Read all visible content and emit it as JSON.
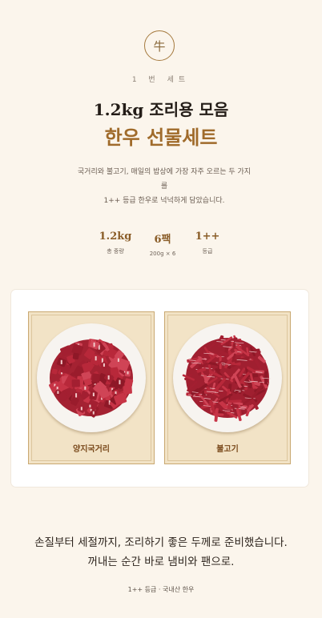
{
  "hero": {
    "emblem_char": "牛",
    "set_number": "1 번 세트",
    "title_line1": "1.2kg 조리용 모음",
    "title_line2": "한우 선물세트",
    "description_line1": "국거리와 불고기, 매일의 밥상에 가장 자주 오르는 두 가지",
    "description_line2": "를",
    "description_line3": "1++ 등급 한우로 넉넉하게 담았습니다."
  },
  "stats": [
    {
      "value": "1.2kg",
      "label": "총 중량"
    },
    {
      "value": "6팩",
      "label": "200g × 6"
    },
    {
      "value": "1++",
      "label": "등급"
    }
  ],
  "products": [
    {
      "name": "양지국거리",
      "icon": "cubed-beef-plate-image"
    },
    {
      "name": "불고기",
      "icon": "sliced-beef-plate-image"
    }
  ],
  "closing": {
    "line1": "손질부터 세절까지, 조리하기 좋은 두께로 준비했습니다.",
    "line2": "꺼내는 순간 바로 냄비와 팬으로.",
    "note": "1++ 등급 · 국내산 한우"
  },
  "colors": {
    "background": "#fbf5ec",
    "accent_gold": "#a06b2b",
    "panel_beige": "#f2e3c6",
    "meat_red": "#b8283a"
  }
}
